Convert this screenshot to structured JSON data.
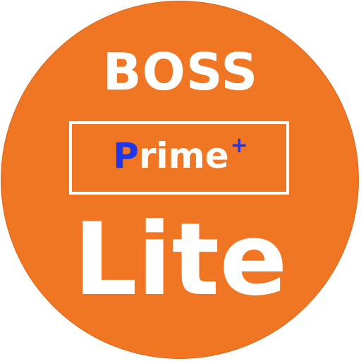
{
  "logo": {
    "top_text": "BOSS",
    "prime_initial": "P",
    "prime_rest": "rime",
    "prime_plus": "+",
    "bottom_text": "Lite"
  },
  "colors": {
    "badge": "#f07624",
    "text": "#ffffff",
    "accent": "#1f37e8"
  }
}
